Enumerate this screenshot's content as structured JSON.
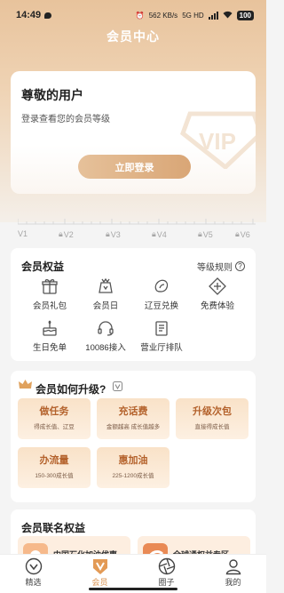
{
  "status_bar": {
    "time": "14:49",
    "speed": "562 KB/s",
    "network": "5G HD",
    "battery": "100"
  },
  "header": {
    "title": "会员中心"
  },
  "user_card": {
    "title": "尊敬的用户",
    "subtitle": "登录查看您的会员等级",
    "login_label": "立即登录"
  },
  "levels": [
    "V1",
    "V2",
    "V3",
    "V4",
    "V5",
    "V6"
  ],
  "benefits": {
    "title": "会员权益",
    "rules_label": "等级规则",
    "items": [
      {
        "label": "会员礼包",
        "icon": "gift-icon"
      },
      {
        "label": "会员日",
        "icon": "crown-bag-icon"
      },
      {
        "label": "辽豆兑换",
        "icon": "bean-icon"
      },
      {
        "label": "免费体验",
        "icon": "plus-diamond-icon"
      },
      {
        "label": "生日免单",
        "icon": "cake-icon"
      },
      {
        "label": "10086接入",
        "icon": "headset-icon"
      },
      {
        "label": "营业厅排队",
        "icon": "queue-ticket-icon"
      }
    ]
  },
  "upgrade": {
    "title": "会员如何升级?",
    "items": [
      {
        "name": "做任务",
        "desc": "得成长值、辽豆"
      },
      {
        "name": "充话费",
        "desc": "金额越高 成长值越多"
      },
      {
        "name": "升级次包",
        "desc": "直接得成长值"
      },
      {
        "name": "办流量",
        "desc": "150-300成长值"
      },
      {
        "name": "惠加油",
        "desc": "225-1200成长值"
      }
    ]
  },
  "cobrand": {
    "title": "会员联名权益",
    "items": [
      {
        "label": "中国石化加油优惠"
      },
      {
        "label": "全球通权益专区"
      }
    ]
  },
  "tabbar": {
    "items": [
      {
        "label": "精选",
        "icon": "compass-icon"
      },
      {
        "label": "会员",
        "icon": "vip-icon",
        "active": true
      },
      {
        "label": "圈子",
        "icon": "aperture-icon"
      },
      {
        "label": "我的",
        "icon": "user-icon"
      }
    ]
  },
  "colors": {
    "accent": "#d98f4b",
    "gold": "#e6c19a",
    "upgrade_text": "#b4622c"
  }
}
